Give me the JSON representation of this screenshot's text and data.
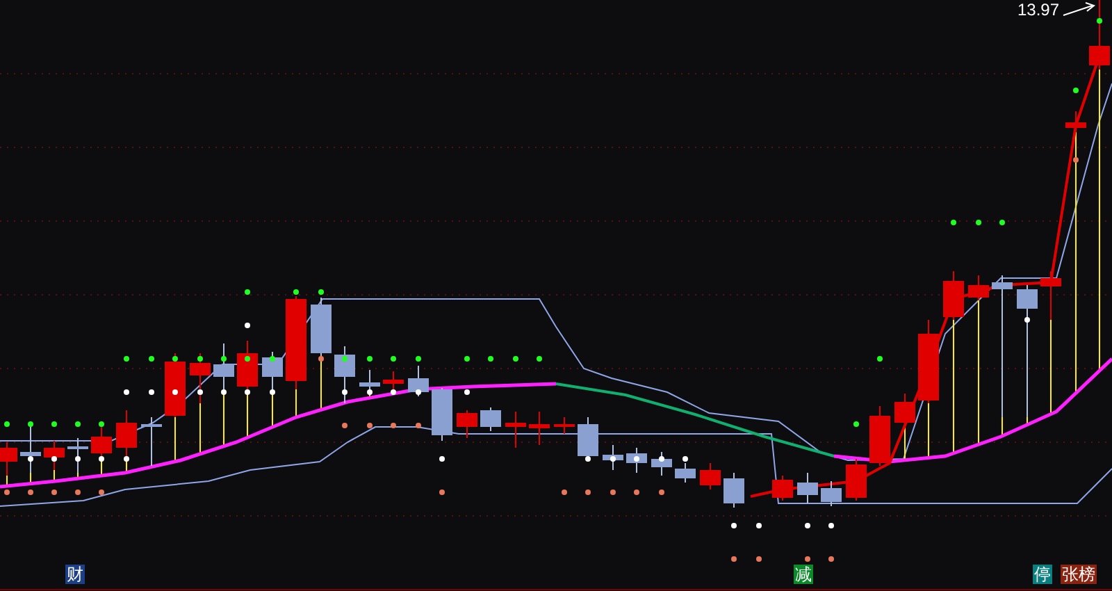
{
  "chart": {
    "price_label": "13.97"
  },
  "markers": [
    {
      "text": "财",
      "color": "#1c3f86"
    },
    {
      "text": "减",
      "color": "#0a8a28"
    },
    {
      "text": "停",
      "color": "#0b7f7f"
    },
    {
      "text": "张榜",
      "color": "#8a2410"
    }
  ]
}
